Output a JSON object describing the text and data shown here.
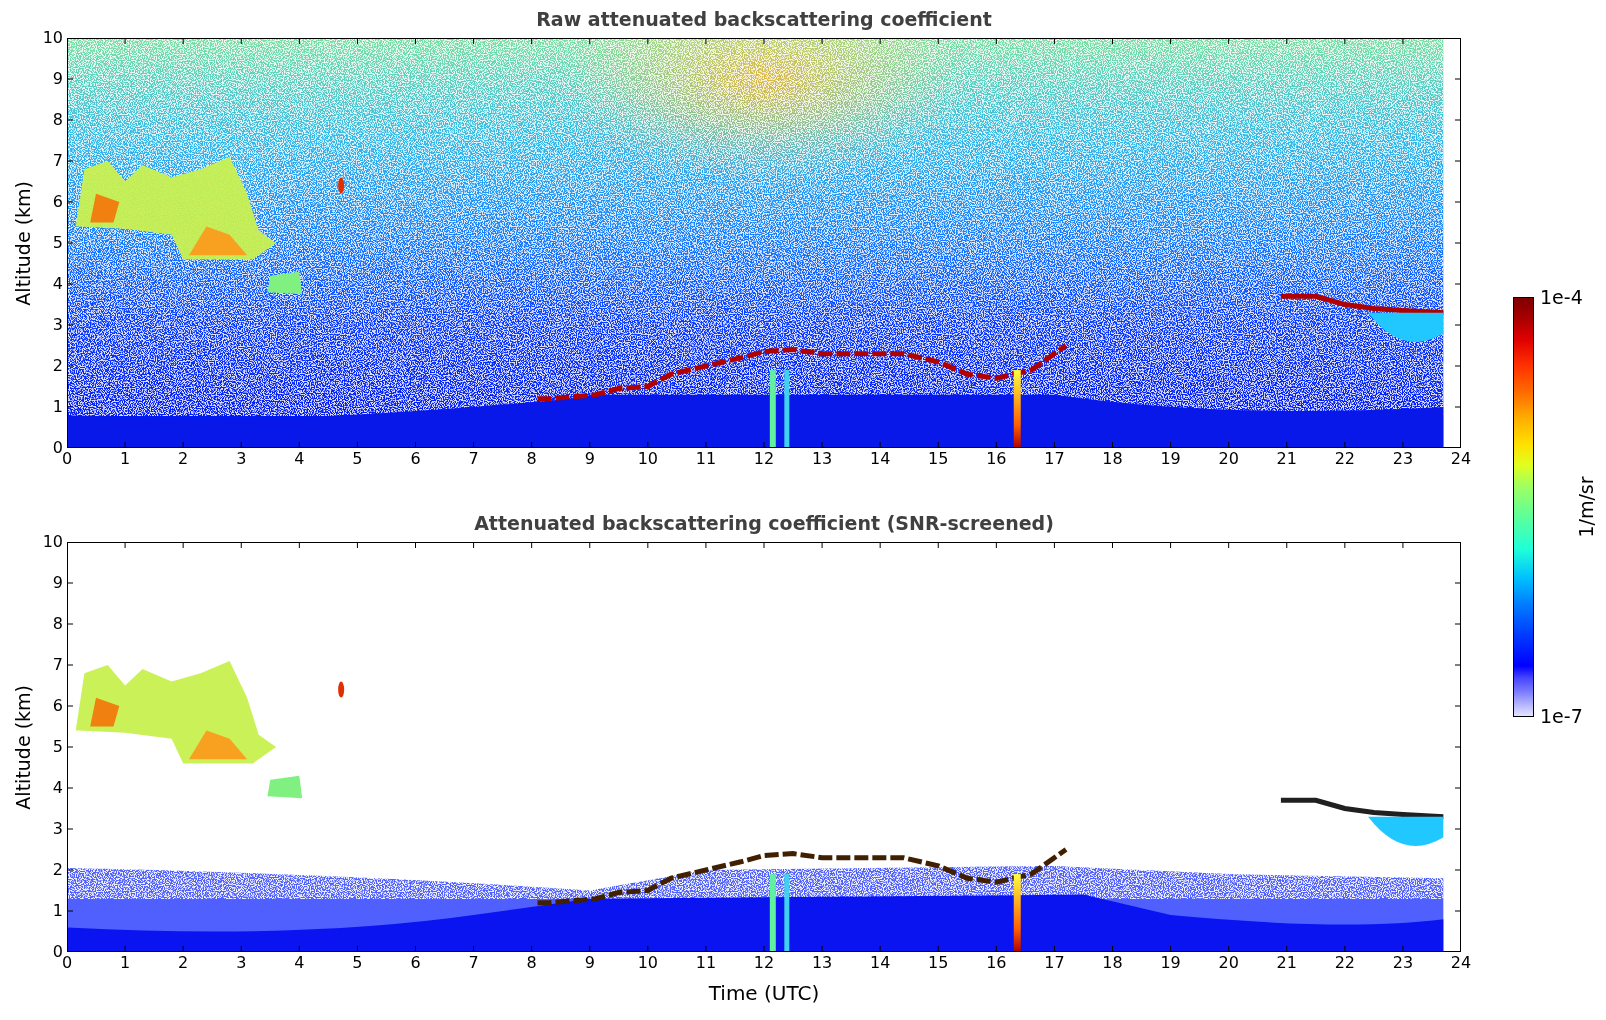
{
  "panels": [
    {
      "kind": "raw",
      "title": "Raw attenuated backscattering coefficient",
      "ylabel": "Altitude (km)",
      "yticks": [
        "10",
        "9",
        "8",
        "7",
        "6",
        "5",
        "4",
        "3",
        "2",
        "1",
        "0"
      ],
      "xticks": [
        "0",
        "1",
        "2",
        "3",
        "4",
        "5",
        "6",
        "7",
        "8",
        "9",
        "10",
        "11",
        "12",
        "13",
        "14",
        "15",
        "16",
        "17",
        "18",
        "19",
        "20",
        "21",
        "22",
        "23",
        "24"
      ]
    },
    {
      "kind": "screened",
      "title": "Attenuated backscattering coefficient (SNR-screened)",
      "ylabel": "Altitude (km)",
      "yticks": [
        "10",
        "9",
        "8",
        "7",
        "6",
        "5",
        "4",
        "3",
        "2",
        "1",
        "0"
      ],
      "xticks": [
        "0",
        "1",
        "2",
        "3",
        "4",
        "5",
        "6",
        "7",
        "8",
        "9",
        "10",
        "11",
        "12",
        "13",
        "14",
        "15",
        "16",
        "17",
        "18",
        "19",
        "20",
        "21",
        "22",
        "23",
        "24"
      ],
      "xlabel": "Time (UTC)"
    }
  ],
  "colorbar": {
    "max_label": "1e-4",
    "min_label": "1e-7",
    "unit": "1/m/sr"
  }
}
